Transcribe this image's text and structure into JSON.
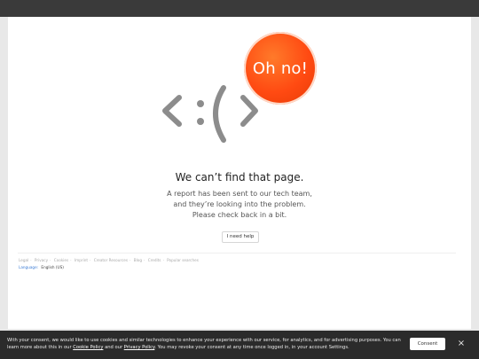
{
  "badge": {
    "text": "Oh no!"
  },
  "error": {
    "title": "We can’t find that page.",
    "line1": "A report has been sent to our tech team,",
    "line2": "and they’re looking into the problem.",
    "line3": "Please check back in a bit.",
    "help_label": "I need help"
  },
  "footer": {
    "links": [
      "Legal",
      "Privacy",
      "Cookies",
      "Imprint",
      "Creator Resources",
      "Blog",
      "Credits",
      "Popular searches"
    ],
    "language_label": "Language:",
    "language_value": "English (US)"
  },
  "consent": {
    "text_part1": "With your consent, we would like to use cookies and similar technologies to enhance your experience with our service, for analytics, and for advertising purposes. You can learn more about this in our ",
    "cookie_link": "Cookie Policy",
    "text_part2": " and our ",
    "privacy_link": "Privacy Policy",
    "text_part3": ". You may revoke your consent at any time once logged in, in your account Settings.",
    "button_label": "Consent",
    "close_icon": "×"
  },
  "colors": {
    "badge": "#ff4a12",
    "face": "#8c8c8c",
    "topbar": "#3a3a3a",
    "consent_bar": "#2b2b2b",
    "link": "#3a7bd5"
  },
  "icons": {
    "face": "sad-face-code-icon",
    "close": "close-icon"
  }
}
